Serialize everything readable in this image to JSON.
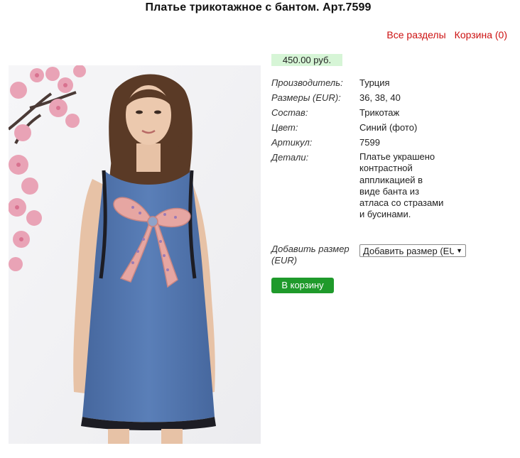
{
  "product": {
    "title": "Платье трикотажное с бантом. Арт.7599",
    "price": "450.00 руб."
  },
  "nav": {
    "all_sections": "Все разделы",
    "cart": "Корзина (0)"
  },
  "specs": [
    {
      "label": "Производитель:",
      "value": "Турция"
    },
    {
      "label": "Размеры (EUR):",
      "value": "36, 38, 40"
    },
    {
      "label": "Состав:",
      "value": "Трикотаж"
    },
    {
      "label": "Цвет:",
      "value": "Синий (фото)"
    },
    {
      "label": "Артикул:",
      "value": "7599"
    },
    {
      "label": "Детали:",
      "value": "Платье украшено контрастной аппликацией в виде банта из атласа со стразами и бусинами."
    }
  ],
  "size_select": {
    "label": "Добавить размер (EUR)",
    "selected": "Добавить размер (EUR)"
  },
  "cart_button": "В корзину",
  "colors": {
    "price_bg": "#d6f5d6",
    "link": "#cc1111",
    "button": "#1f9a2b",
    "dress": "#4f74ad"
  }
}
